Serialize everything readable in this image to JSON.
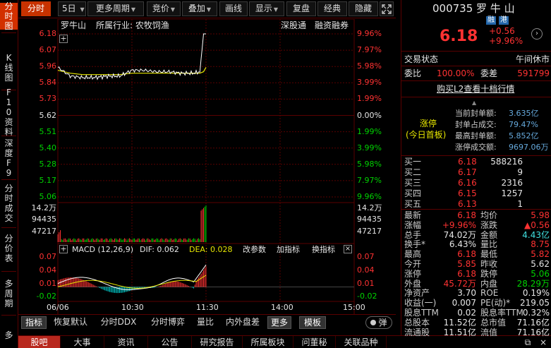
{
  "left_nav": [
    {
      "label": "分时图",
      "active": true
    },
    {
      "label": "K线图"
    },
    {
      "label": "F10资料"
    },
    {
      "label": "深度F9"
    },
    {
      "label": "分时成交"
    },
    {
      "label": "分价表"
    },
    {
      "label": "多周期"
    },
    {
      "label": "多"
    }
  ],
  "toolbar": {
    "fenshi": "分时",
    "days": "5日",
    "more_period": "更多周期",
    "jingjia": "竞价",
    "diejia": "叠加",
    "huaxian": "画线",
    "xianshi": "显示",
    "fupan": "复盘",
    "jingdian": "经典",
    "yincang": "隐藏",
    "dropdown_glyph": "▼"
  },
  "chart": {
    "stock_name": "罗牛山",
    "industry_label": "所属行业: 农牧饲渔",
    "tag_shengutong": "深股通",
    "tag_rongzi": "融资融券",
    "price_axis_left": [
      "6.18",
      "6.07",
      "5.96",
      "5.84",
      "5.73",
      "5.62",
      "5.51",
      "5.40",
      "5.28",
      "5.17",
      "5.06"
    ],
    "price_axis_right": [
      "9.96%",
      "7.97%",
      "5.98%",
      "3.99%",
      "1.99%",
      "0.00%",
      "1.99%",
      "3.99%",
      "5.98%",
      "7.97%",
      "9.96%"
    ],
    "volume_axis": [
      "14.2万",
      "94435",
      "47217"
    ],
    "macd_label": "MACD (12,26,9)",
    "dif_label": "DIF: 0.062",
    "dea_label": "DEA: 0.028",
    "gaicanshu": "改参数",
    "jiazhibiao": "加指标",
    "huanzhibiao": "换指标",
    "macd_axis": [
      "0.07",
      "0.04",
      "0.01",
      "-0.02"
    ],
    "time_axis": [
      "06/06",
      "10:30",
      "11:30",
      "14:00",
      "15:00"
    ],
    "colors": {
      "up": "#ff3232",
      "down": "#00d200",
      "price_line": "#ffffff",
      "avg_line": "#e6e600",
      "grid": "#5a0000"
    }
  },
  "chart_data": {
    "type": "line",
    "title": "罗牛山",
    "xlabel": "",
    "ylabel": "",
    "x": [
      "09:30",
      "09:40",
      "09:50",
      "10:00",
      "10:10",
      "10:20",
      "10:30",
      "10:40",
      "10:50",
      "11:00",
      "11:10",
      "11:20",
      "11:25",
      "11:28",
      "11:30"
    ],
    "series": [
      {
        "name": "price",
        "values": [
          5.95,
          5.89,
          5.88,
          5.88,
          5.89,
          5.89,
          5.93,
          5.93,
          5.92,
          5.92,
          5.91,
          5.91,
          5.92,
          6.18,
          6.18
        ]
      },
      {
        "name": "avg",
        "values": [
          5.93,
          5.91,
          5.9,
          5.9,
          5.9,
          5.9,
          5.91,
          5.91,
          5.91,
          5.91,
          5.91,
          5.91,
          5.91,
          5.92,
          5.95
        ]
      }
    ],
    "ylim": [
      5.06,
      6.18
    ],
    "volume_ylim": [
      0,
      142000
    ],
    "macd_ylim": [
      -0.02,
      0.07
    ],
    "dif": 0.062,
    "dea": 0.028
  },
  "bottom_tabs": {
    "zhibiao": "指标",
    "huifu": "恢复默认",
    "ddx": "分时DDX",
    "boyi": "分时博弈",
    "liangbi": "量比",
    "neiwaipan": "内外盘差",
    "more": "更多",
    "moban": "模板",
    "tan": "弹"
  },
  "bottom_tabs2": [
    "股吧",
    "大事",
    "资讯",
    "公告",
    "研究报告",
    "所属板块",
    "问董秘",
    "关联品种"
  ],
  "right_panel": {
    "code_name": "000735 罗 牛 山",
    "badge1": "融",
    "badge2": "港",
    "price": "6.18",
    "change": "+0.56",
    "change_pct": "+9.96%",
    "trade_state_label": "交易状态",
    "trade_state": "午间休市",
    "weibi_label": "委比",
    "weibi": "100.00%",
    "weicha_label": "委差",
    "weicha": "591799",
    "buy_l2": "购买L2查看十档行情",
    "zhangting": "涨停",
    "first_board": "(今日首板)",
    "seal_rows": [
      {
        "label": "当前封单额:",
        "value": "3.635亿"
      },
      {
        "label": "封单占成交:",
        "value": "79.47%"
      },
      {
        "label": "最高封单额:",
        "value": "5.852亿"
      },
      {
        "label": "涨停成交额:",
        "value": "9697.06万"
      }
    ],
    "sell_rows": [
      {
        "label": "卖五",
        "price": "",
        "vol": ""
      },
      {
        "label": "卖四",
        "price": "",
        "vol": ""
      },
      {
        "label": "卖三",
        "price": "",
        "vol": ""
      },
      {
        "label": "卖二",
        "price": "",
        "vol": ""
      },
      {
        "label": "卖一",
        "price": "",
        "vol": ""
      }
    ],
    "buy_rows": [
      {
        "label": "买一",
        "price": "6.18",
        "vol": "588216"
      },
      {
        "label": "买二",
        "price": "6.17",
        "vol": "9"
      },
      {
        "label": "买三",
        "price": "6.16",
        "vol": "2316"
      },
      {
        "label": "买四",
        "price": "6.15",
        "vol": "1257"
      },
      {
        "label": "买五",
        "price": "6.13",
        "vol": "1"
      }
    ],
    "stats": [
      {
        "l1": "最新",
        "v1": "6.18",
        "c1": "red",
        "l2": "均价",
        "v2": "5.98",
        "c2": "red"
      },
      {
        "l1": "涨幅",
        "v1": "+9.96%",
        "c1": "red",
        "l2": "涨跌",
        "v2": "▲0.56",
        "c2": "red"
      },
      {
        "l1": "总手",
        "v1": "74.02万",
        "c1": "wht",
        "l2": "金额",
        "v2": "4.43亿",
        "c2": "cyn"
      },
      {
        "l1": "换手*",
        "v1": "6.43%",
        "c1": "wht",
        "l2": "量比",
        "v2": "8.75",
        "c2": "red"
      },
      {
        "l1": "最高",
        "v1": "6.18",
        "c1": "red",
        "l2": "最低",
        "v2": "5.82",
        "c2": "red"
      },
      {
        "l1": "今开",
        "v1": "5.85",
        "c1": "red",
        "l2": "昨收",
        "v2": "5.62",
        "c2": "wht"
      },
      {
        "l1": "涨停",
        "v1": "6.18",
        "c1": "red",
        "l2": "跌停",
        "v2": "5.06",
        "c2": "grn"
      },
      {
        "l1": "外盘",
        "v1": "45.72万",
        "c1": "red",
        "l2": "内盘",
        "v2": "28.29万",
        "c2": "grn"
      },
      {
        "l1": "净资产",
        "v1": "3.70",
        "c1": "wht",
        "l2": "ROE",
        "v2": "0.19%",
        "c2": "wht"
      },
      {
        "l1": "收益(一)",
        "v1": "0.007",
        "c1": "wht",
        "l2": "PE(动)*",
        "v2": "219.05",
        "c2": "wht"
      },
      {
        "l1": "股息TTM",
        "v1": "0.02",
        "c1": "wht",
        "l2": "股息率TTM",
        "v2": "0.32%",
        "c2": "wht"
      },
      {
        "l1": "总股本",
        "v1": "11.52亿",
        "c1": "wht",
        "l2": "总市值",
        "v2": "71.16亿",
        "c2": "wht"
      },
      {
        "l1": "流通股",
        "v1": "11.51亿",
        "c1": "wht",
        "l2": "流值",
        "v2": "71.16亿",
        "c2": "wht"
      }
    ]
  }
}
